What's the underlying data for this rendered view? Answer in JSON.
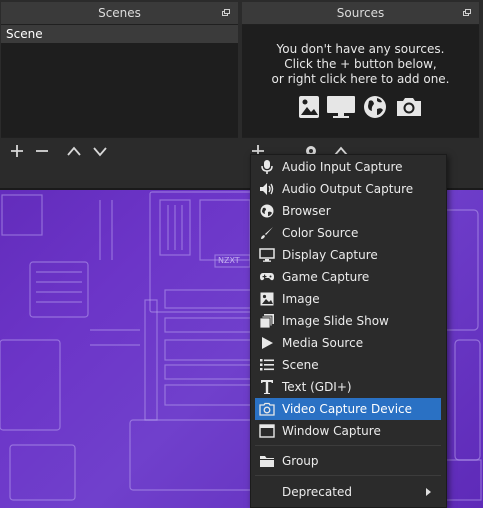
{
  "scenes_panel": {
    "title": "Scenes",
    "items": [
      "Scene"
    ]
  },
  "sources_panel": {
    "title": "Sources",
    "empty_message": [
      "You don't have any sources.",
      "Click the + button below,",
      "or right click here to add one."
    ]
  },
  "context_menu": {
    "items": [
      {
        "label": "Audio Input Capture",
        "icon": "microphone-icon"
      },
      {
        "label": "Audio Output Capture",
        "icon": "speaker-icon"
      },
      {
        "label": "Browser",
        "icon": "globe-icon"
      },
      {
        "label": "Color Source",
        "icon": "brush-icon"
      },
      {
        "label": "Display Capture",
        "icon": "monitor-icon"
      },
      {
        "label": "Game Capture",
        "icon": "gamepad-icon"
      },
      {
        "label": "Image",
        "icon": "image-icon"
      },
      {
        "label": "Image Slide Show",
        "icon": "slideshow-icon"
      },
      {
        "label": "Media Source",
        "icon": "play-icon"
      },
      {
        "label": "Scene",
        "icon": "list-icon"
      },
      {
        "label": "Text (GDI+)",
        "icon": "text-icon"
      },
      {
        "label": "Video Capture Device",
        "icon": "camera-icon",
        "selected": true
      },
      {
        "label": "Window Capture",
        "icon": "window-icon"
      },
      {
        "label": "Group",
        "icon": "folder-icon"
      },
      {
        "label": "Deprecated",
        "icon": "",
        "submenu": true
      }
    ]
  },
  "colors": {
    "accent": "#2a71c4",
    "panel_bg": "#1e1e1e",
    "menu_bg": "#2b2b2b",
    "preview_bg": "#6a2fc0"
  }
}
